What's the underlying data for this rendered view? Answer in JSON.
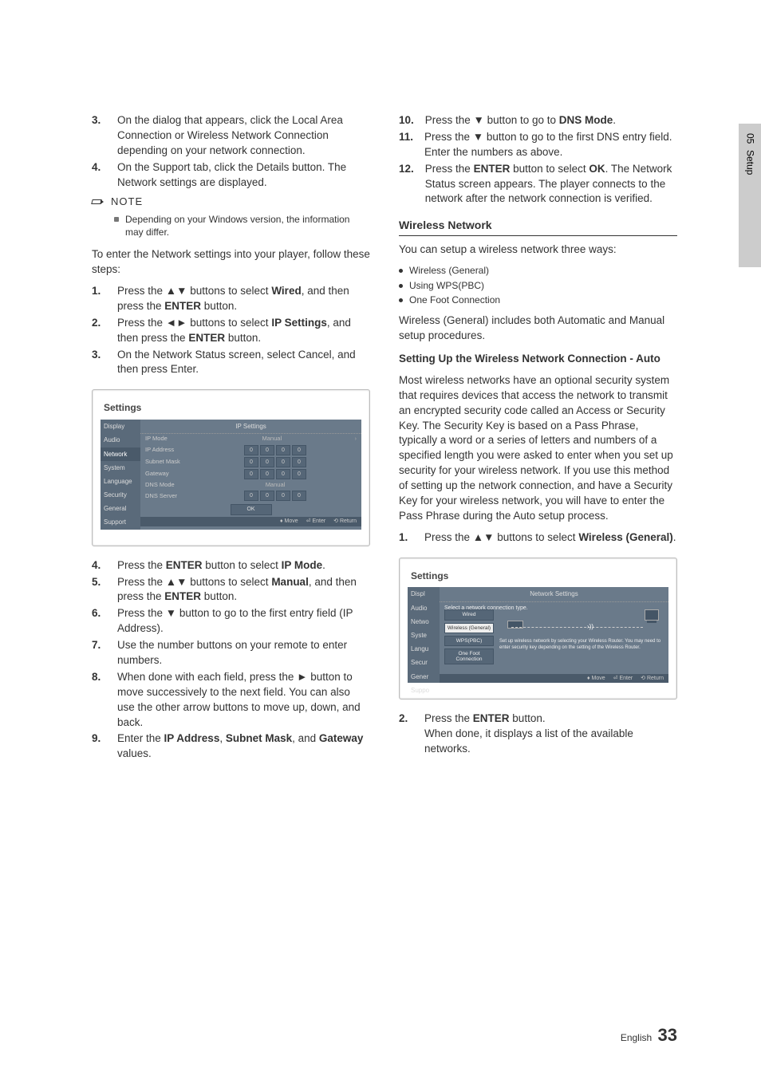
{
  "sideTab": {
    "chapter": "05",
    "section": "Setup"
  },
  "left": {
    "steps_a": [
      {
        "n": "3.",
        "t": "On the dialog that appears, click the Local Area Connection or Wireless Network Connection depending on your network connection."
      },
      {
        "n": "4.",
        "t": "On the Support tab, click the Details button. The Network settings are displayed."
      }
    ],
    "noteLabel": "NOTE",
    "noteItems": [
      "Depending on your Windows version, the information may differ."
    ],
    "intro": "To enter the Network settings into your player, follow these steps:",
    "steps_b": [
      {
        "n": "1.",
        "pre": "Press the ▲▼ buttons to select ",
        "bold": "Wired",
        "post": ", and then press the ",
        "bold2": "ENTER",
        "tail": " button."
      },
      {
        "n": "2.",
        "pre": "Press the ◄► buttons to select ",
        "bold": "IP Settings",
        "post": ", and then press the ",
        "bold2": "ENTER",
        "tail": " button."
      },
      {
        "n": "3.",
        "pre": "On the Network Status screen, select Cancel, and then press Enter.",
        "bold": "",
        "post": "",
        "bold2": "",
        "tail": ""
      }
    ],
    "panel": {
      "title": "Settings",
      "header": "IP Settings",
      "menu": [
        "Display",
        "Audio",
        "Network",
        "System",
        "Language",
        "Security",
        "General",
        "Support"
      ],
      "active": "Network",
      "rows": {
        "ipMode": {
          "label": "IP Mode",
          "value": "Manual"
        },
        "ipAddr": {
          "label": "IP Address",
          "fields": [
            "0",
            "0",
            "0",
            "0"
          ]
        },
        "subnet": {
          "label": "Subnet Mask",
          "fields": [
            "0",
            "0",
            "0",
            "0"
          ]
        },
        "gateway": {
          "label": "Gateway",
          "fields": [
            "0",
            "0",
            "0",
            "0"
          ]
        },
        "dnsMode": {
          "label": "DNS Mode",
          "value": "Manual"
        },
        "dnsSrv": {
          "label": "DNS Server",
          "fields": [
            "0",
            "0",
            "0",
            "0"
          ]
        }
      },
      "ok": "OK",
      "hints": {
        "move": "Move",
        "enter": "Enter",
        "ret": "Return"
      }
    },
    "steps_c": [
      {
        "n": "4.",
        "html": "Press the <b>ENTER</b> button to select <b>IP Mode</b>."
      },
      {
        "n": "5.",
        "html": "Press the ▲▼ buttons to select <b>Manual</b>, and then press the <b>ENTER</b> button."
      },
      {
        "n": "6.",
        "html": "Press the ▼ button to go to the first entry field (IP Address)."
      },
      {
        "n": "7.",
        "html": "Use the number buttons on your remote to enter numbers."
      },
      {
        "n": "8.",
        "html": "When done with each field, press the ► button to move successively to the next field. You can also use the other arrow buttons to move up, down, and back."
      },
      {
        "n": "9.",
        "html": "Enter the <b>IP Address</b>, <b>Subnet Mask</b>, and <b>Gateway</b> values."
      }
    ]
  },
  "right": {
    "steps_top": [
      {
        "n": "10.",
        "html": "Press the ▼ button to go to <b>DNS Mode</b>."
      },
      {
        "n": "11.",
        "html": "Press the ▼ button to go to the first DNS entry field. Enter the numbers as above."
      },
      {
        "n": "12.",
        "html": "Press the <b>ENTER</b> button to select <b>OK</b>. The Network Status screen appears. The player connects to the network after the network connection is verified."
      }
    ],
    "h3": "Wireless Network",
    "intro": "You can setup a wireless network three ways:",
    "bullets": [
      "Wireless (General)",
      "Using WPS(PBC)",
      "One Foot Connection"
    ],
    "desc": "Wireless (General) includes both Automatic and Manual setup procedures.",
    "h4": "Setting Up the Wireless Network Connection - Auto",
    "autoPara": "Most wireless networks have an optional security system that requires devices that access the network to transmit an encrypted security code called an Access or Security Key. The Security Key is based on a Pass Phrase, typically a word or a series of letters and numbers of a specified length you were asked to enter when you set up security for your wireless network. If you use this method of setting up the network connection, and have a Security Key for your wireless network, you will have to enter the Pass Phrase during the Auto setup process.",
    "step1": {
      "n": "1.",
      "html": "Press the ▲▼ buttons to select <b>Wireless (General)</b>."
    },
    "panel": {
      "title": "Settings",
      "header": "Network Settings",
      "subhead": "Select a network connection type.",
      "menu": [
        "Display",
        "Audio",
        "Network",
        "System",
        "Language",
        "Security",
        "General",
        "Support"
      ],
      "buttons": [
        "Wired",
        "Wireless (General)",
        "WPS(PBC)",
        "One Foot Connection"
      ],
      "selected": "Wireless (General)",
      "desc": "Set up wireless network by selecting your Wireless Router. You may need to enter security key depending on the setting of the Wireless Router.",
      "hints": {
        "move": "Move",
        "enter": "Enter",
        "ret": "Return"
      }
    },
    "step2": {
      "n": "2.",
      "html": "Press the <b>ENTER</b> button.<br>When done, it displays a list of the available networks."
    }
  },
  "footer": {
    "lang": "English",
    "page": "33"
  }
}
